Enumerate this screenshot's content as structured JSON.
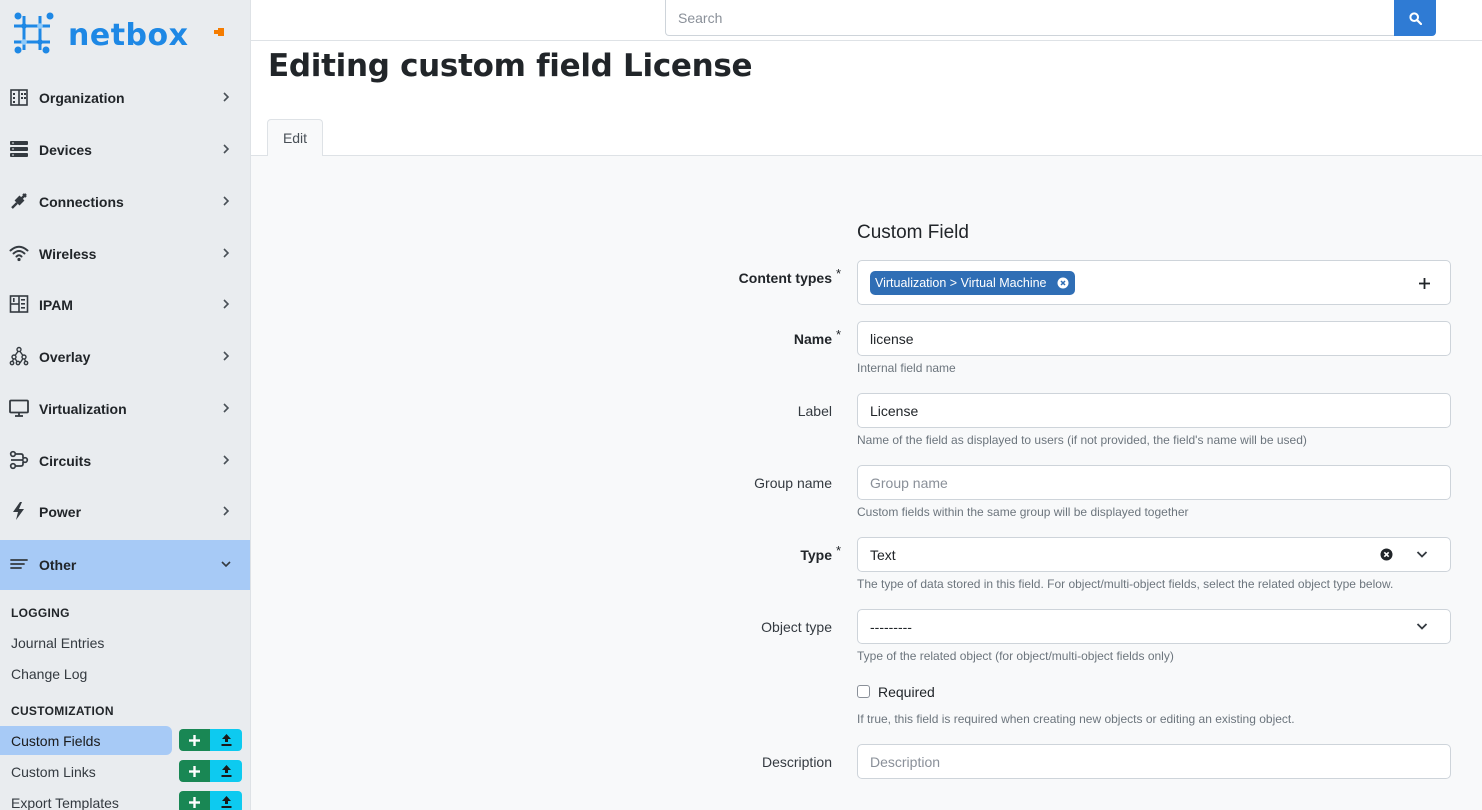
{
  "brand": {
    "name": "netbox"
  },
  "search": {
    "placeholder": "Search"
  },
  "page": {
    "title": "Editing custom field License"
  },
  "tabs": [
    {
      "label": "Edit"
    }
  ],
  "sidebar": {
    "items": [
      {
        "label": "Organization",
        "icon": "building-icon"
      },
      {
        "label": "Devices",
        "icon": "server-icon"
      },
      {
        "label": "Connections",
        "icon": "cable-icon"
      },
      {
        "label": "Wireless",
        "icon": "wifi-icon"
      },
      {
        "label": "IPAM",
        "icon": "ipam-icon"
      },
      {
        "label": "Overlay",
        "icon": "graph-icon"
      },
      {
        "label": "Virtualization",
        "icon": "monitor-icon"
      },
      {
        "label": "Circuits",
        "icon": "circuits-icon"
      },
      {
        "label": "Power",
        "icon": "lightning-icon"
      },
      {
        "label": "Other",
        "icon": "list-icon",
        "expanded": true
      }
    ],
    "groups": [
      {
        "heading": "LOGGING",
        "links": [
          {
            "label": "Journal Entries"
          },
          {
            "label": "Change Log"
          }
        ]
      },
      {
        "heading": "CUSTOMIZATION",
        "links": [
          {
            "label": "Custom Fields",
            "active": true
          },
          {
            "label": "Custom Links"
          },
          {
            "label": "Export Templates"
          }
        ]
      }
    ]
  },
  "form": {
    "section_title": "Custom Field",
    "content_types": {
      "label": "Content types",
      "required": true,
      "chips": [
        "Virtualization > Virtual Machine"
      ]
    },
    "name": {
      "label": "Name",
      "required": true,
      "value": "license",
      "help": "Internal field name"
    },
    "label_field": {
      "label": "Label",
      "value": "License",
      "help": "Name of the field as displayed to users (if not provided, the field's name will be used)"
    },
    "group_name": {
      "label": "Group name",
      "placeholder": "Group name",
      "help": "Custom fields within the same group will be displayed together"
    },
    "type": {
      "label": "Type",
      "required": true,
      "value": "Text",
      "help": "The type of data stored in this field. For object/multi-object fields, select the related object type below."
    },
    "object_type": {
      "label": "Object type",
      "value": "---------",
      "help": "Type of the related object (for object/multi-object fields only)"
    },
    "required_field": {
      "label": "Required",
      "checked": false,
      "help": "If true, this field is required when creating new objects or editing an existing object."
    },
    "description": {
      "label": "Description",
      "placeholder": "Description"
    }
  },
  "colors": {
    "accent": "#2f7bd4",
    "sidebar_bg": "#e9ecef",
    "active_bg": "#a7caf6",
    "add_button": "#198754",
    "import_button": "#0dcaf0",
    "chip_bg": "#2f6eb5"
  }
}
